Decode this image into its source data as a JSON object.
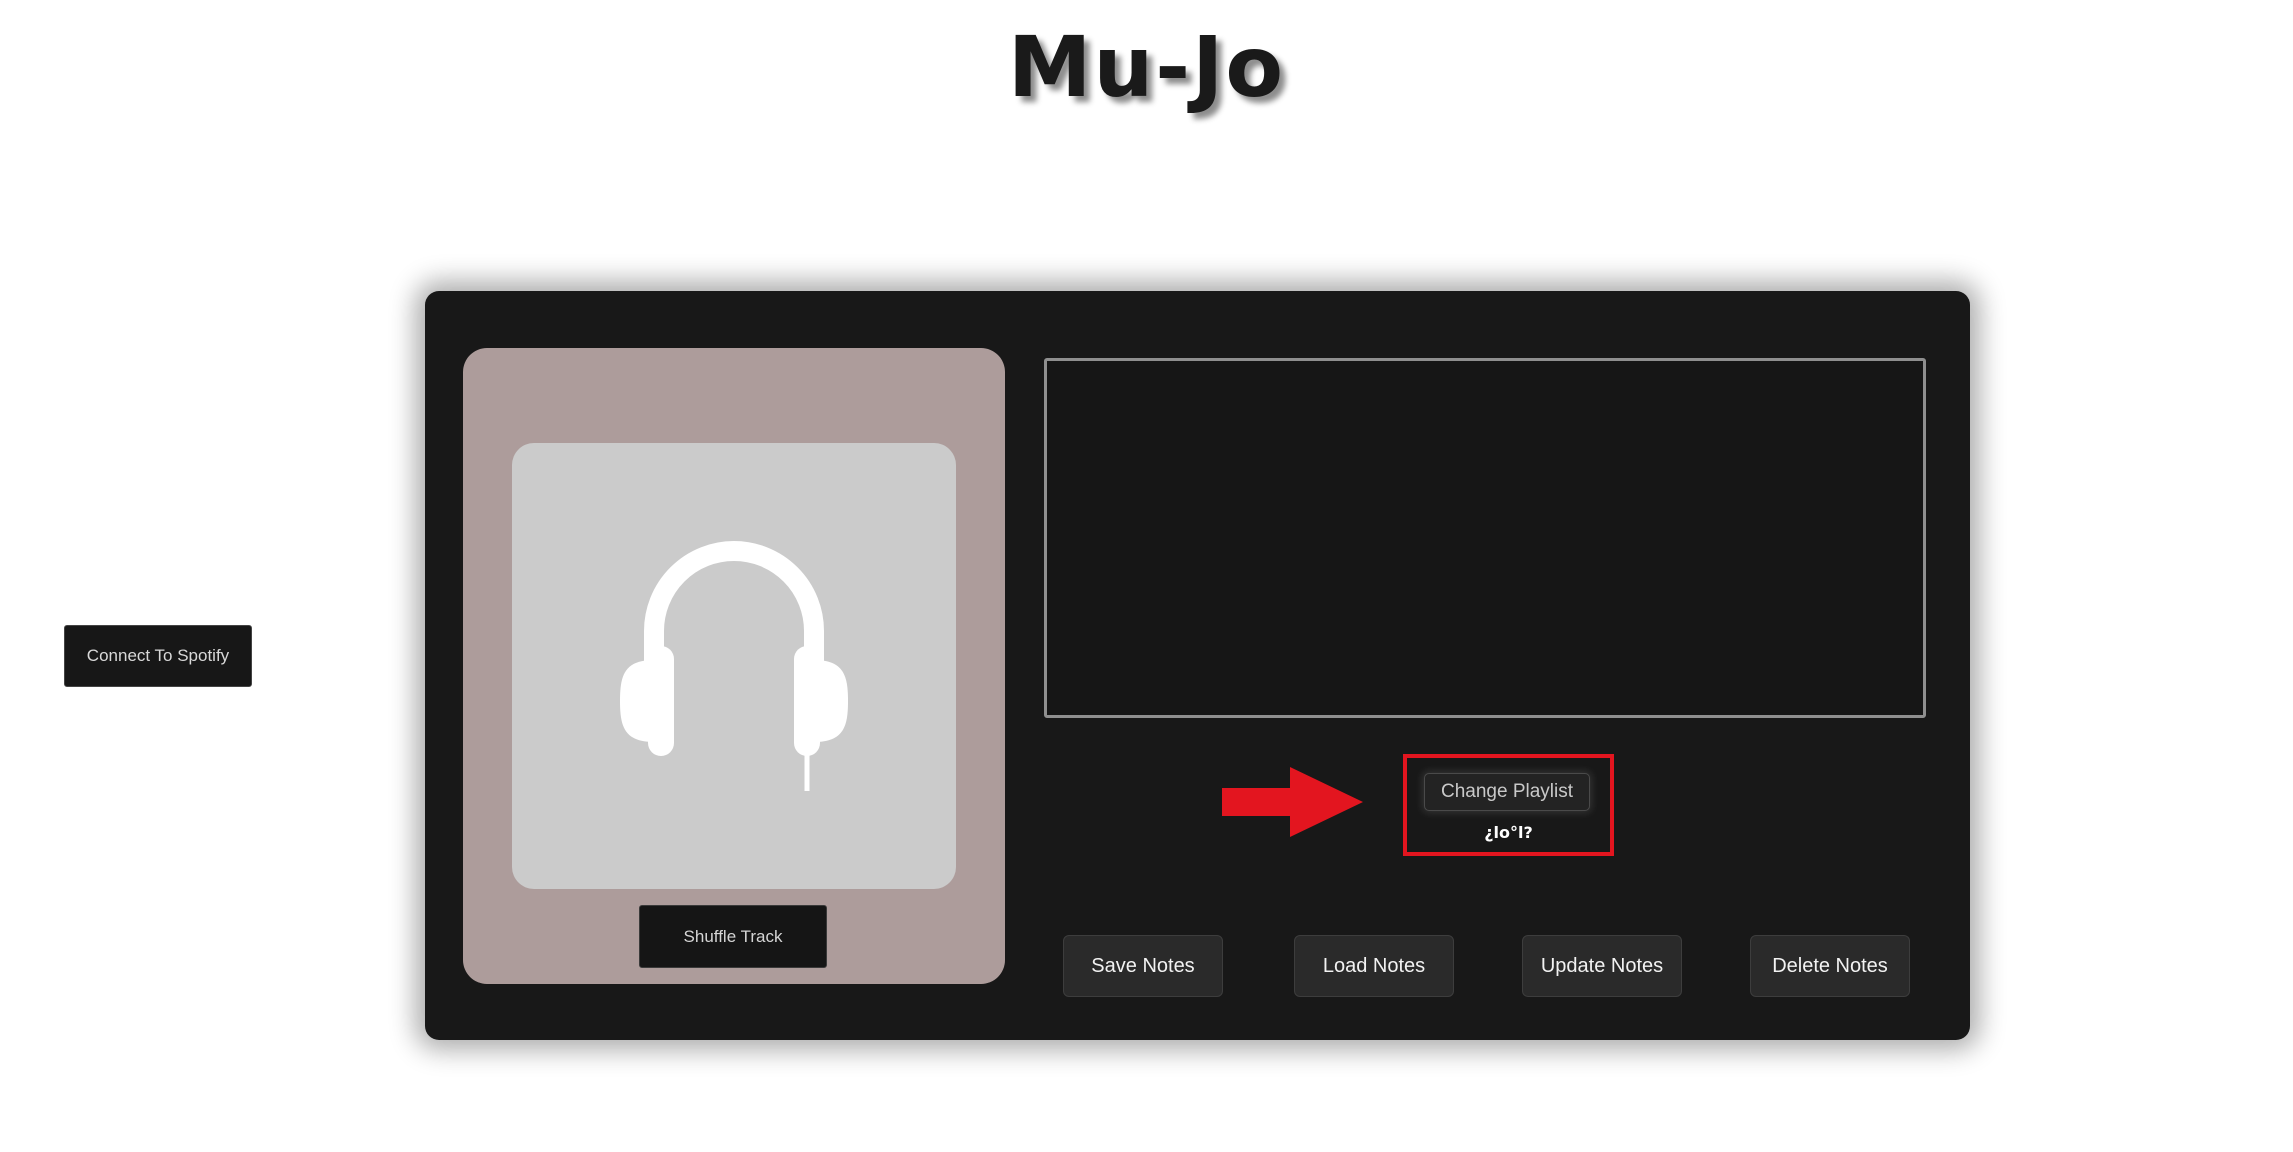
{
  "app": {
    "title": "Mu-Jo"
  },
  "spotify": {
    "connect_label": "Connect To Spotify"
  },
  "player": {
    "artwork_icon": "headphones-icon",
    "shuffle_label": "Shuffle Track"
  },
  "notes": {
    "value": "",
    "placeholder": ""
  },
  "playlist": {
    "change_label": "Change Playlist",
    "current_name": "¿lo°l?"
  },
  "actions": {
    "save_label": "Save Notes",
    "load_label": "Load Notes",
    "update_label": "Update Notes",
    "delete_label": "Delete Notes"
  },
  "colors": {
    "panel_bg": "#181818",
    "player_bg": "#ad9c9b",
    "artwork_bg": "#cbcbcb",
    "highlight": "#e3151f"
  }
}
